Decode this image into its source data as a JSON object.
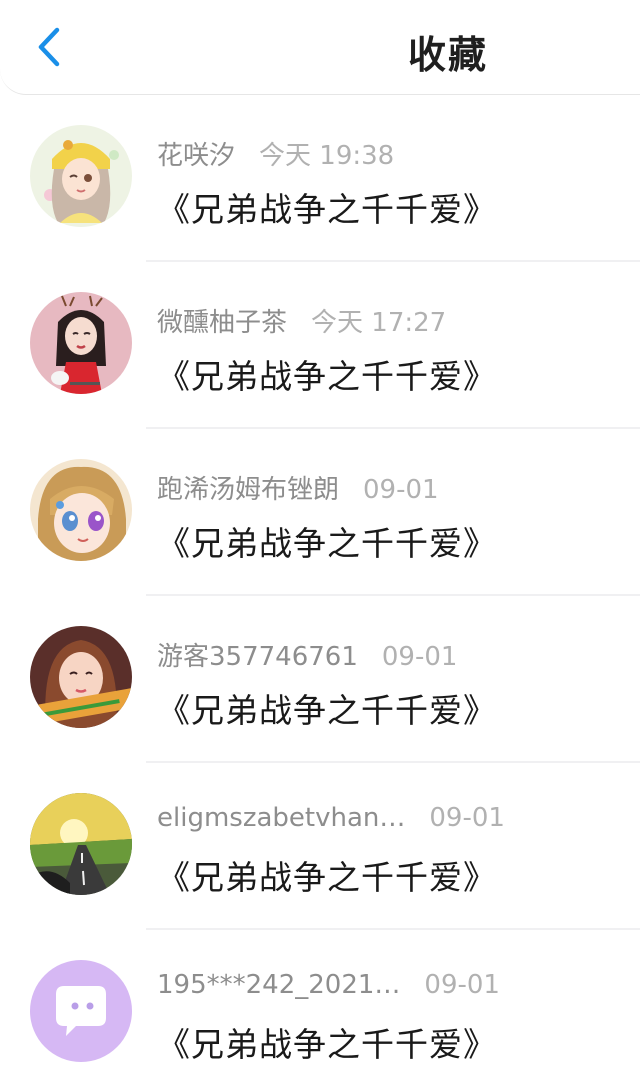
{
  "header": {
    "title": "收藏",
    "back_icon": "chevron-left-icon",
    "accent": "#1a8fe8"
  },
  "favorites": [
    {
      "username": "花咲汐",
      "time": "今天 19:38",
      "title": "《兄弟战争之千千爱》"
    },
    {
      "username": "微醺柚子茶",
      "time": "今天 17:27",
      "title": "《兄弟战争之千千爱》"
    },
    {
      "username": "跑浠汤姆布锉朗",
      "time": "09-01",
      "title": "《兄弟战争之千千爱》"
    },
    {
      "username": "游客357746761",
      "time": "09-01",
      "title": "《兄弟战争之千千爱》"
    },
    {
      "username": "eligmszabetvhan…",
      "time": "09-01",
      "title": "《兄弟战争之千千爱》"
    },
    {
      "username": "195***242_2021…",
      "time": "09-01",
      "title": "《兄弟战争之千千爱》"
    }
  ]
}
